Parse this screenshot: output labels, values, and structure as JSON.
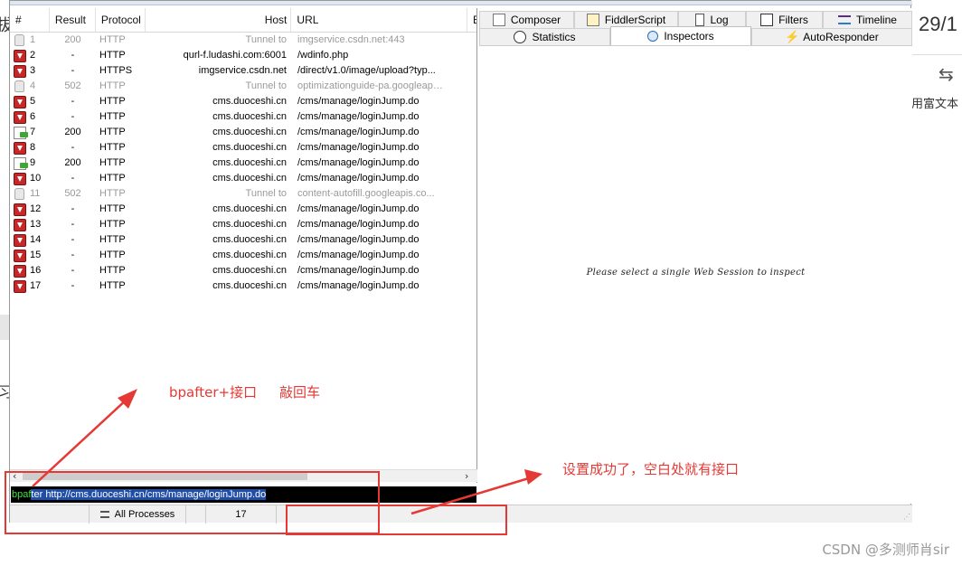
{
  "background": {
    "date_fragment": "29/1",
    "swap_glyph": "⇆",
    "richtext_fragment": "用富文本",
    "left_glyph_top": "拔",
    "left_glyph_bottom": "习"
  },
  "sessions": {
    "columns": [
      "#",
      "Result",
      "Protocol",
      "Host",
      "URL",
      "B"
    ],
    "rows": [
      {
        "num": "1",
        "result": "200",
        "protocol": "HTTP",
        "host": "Tunnel to",
        "url": "imgservice.csdn.net:443",
        "icon": "lock-icon",
        "dim": true
      },
      {
        "num": "2",
        "result": "-",
        "protocol": "HTTP",
        "host": "qurl-f.ludashi.com:6001",
        "url": "/wdinfo.php",
        "icon": "breakpoint-icon",
        "dim": false
      },
      {
        "num": "3",
        "result": "-",
        "protocol": "HTTPS",
        "host": "imgservice.csdn.net",
        "url": "/direct/v1.0/image/upload?typ...",
        "icon": "breakpoint-icon",
        "dim": false
      },
      {
        "num": "4",
        "result": "502",
        "protocol": "HTTP",
        "host": "Tunnel to",
        "url": "optimizationguide-pa.googleapi...",
        "icon": "lock-icon",
        "dim": true
      },
      {
        "num": "5",
        "result": "-",
        "protocol": "HTTP",
        "host": "cms.duoceshi.cn",
        "url": "/cms/manage/loginJump.do",
        "icon": "breakpoint-icon",
        "dim": false
      },
      {
        "num": "6",
        "result": "-",
        "protocol": "HTTP",
        "host": "cms.duoceshi.cn",
        "url": "/cms/manage/loginJump.do",
        "icon": "breakpoint-icon",
        "dim": false
      },
      {
        "num": "7",
        "result": "200",
        "protocol": "HTTP",
        "host": "cms.duoceshi.cn",
        "url": "/cms/manage/loginJump.do",
        "icon": "response-icon",
        "dim": false
      },
      {
        "num": "8",
        "result": "-",
        "protocol": "HTTP",
        "host": "cms.duoceshi.cn",
        "url": "/cms/manage/loginJump.do",
        "icon": "breakpoint-icon",
        "dim": false
      },
      {
        "num": "9",
        "result": "200",
        "protocol": "HTTP",
        "host": "cms.duoceshi.cn",
        "url": "/cms/manage/loginJump.do",
        "icon": "response-icon",
        "dim": false
      },
      {
        "num": "10",
        "result": "-",
        "protocol": "HTTP",
        "host": "cms.duoceshi.cn",
        "url": "/cms/manage/loginJump.do",
        "icon": "breakpoint-icon",
        "dim": false
      },
      {
        "num": "11",
        "result": "502",
        "protocol": "HTTP",
        "host": "Tunnel to",
        "url": "content-autofill.googleapis.co...",
        "icon": "lock-icon",
        "dim": true
      },
      {
        "num": "12",
        "result": "-",
        "protocol": "HTTP",
        "host": "cms.duoceshi.cn",
        "url": "/cms/manage/loginJump.do",
        "icon": "breakpoint-icon",
        "dim": false
      },
      {
        "num": "13",
        "result": "-",
        "protocol": "HTTP",
        "host": "cms.duoceshi.cn",
        "url": "/cms/manage/loginJump.do",
        "icon": "breakpoint-icon",
        "dim": false
      },
      {
        "num": "14",
        "result": "-",
        "protocol": "HTTP",
        "host": "cms.duoceshi.cn",
        "url": "/cms/manage/loginJump.do",
        "icon": "breakpoint-icon",
        "dim": false
      },
      {
        "num": "15",
        "result": "-",
        "protocol": "HTTP",
        "host": "cms.duoceshi.cn",
        "url": "/cms/manage/loginJump.do",
        "icon": "breakpoint-icon",
        "dim": false
      },
      {
        "num": "16",
        "result": "-",
        "protocol": "HTTP",
        "host": "cms.duoceshi.cn",
        "url": "/cms/manage/loginJump.do",
        "icon": "breakpoint-icon",
        "dim": false
      },
      {
        "num": "17",
        "result": "-",
        "protocol": "HTTP",
        "host": "cms.duoceshi.cn",
        "url": "/cms/manage/loginJump.do",
        "icon": "breakpoint-icon",
        "dim": false
      }
    ]
  },
  "quickexec": {
    "prefix": "bpaf",
    "selected": "ter http://cms.duoceshi.cn/cms/manage/loginJump.do"
  },
  "statusbar": {
    "filter": "All Processes",
    "count": "17"
  },
  "tabs": {
    "row1": [
      {
        "label": "Composer",
        "icon": "composer-icon"
      },
      {
        "label": "FiddlerScript",
        "icon": "script-icon"
      },
      {
        "label": "Log",
        "icon": "log-icon"
      },
      {
        "label": "Filters",
        "icon": "filter-icon"
      },
      {
        "label": "Timeline",
        "icon": "timeline-icon"
      }
    ],
    "row2": [
      {
        "label": "Statistics",
        "icon": "stopwatch-icon"
      },
      {
        "label": "Inspectors",
        "icon": "inspector-icon"
      },
      {
        "label": "AutoResponder",
        "icon": "autoresponder-icon"
      }
    ]
  },
  "inspector_empty_message": "Please select a single Web Session to inspect",
  "annotations": {
    "note1_a": "bpafter+接口",
    "note1_b": "敲回车",
    "note2": "设置成功了，空白处就有接口",
    "color": "#e53935"
  },
  "watermark": "CSDN @多测师肖sir"
}
